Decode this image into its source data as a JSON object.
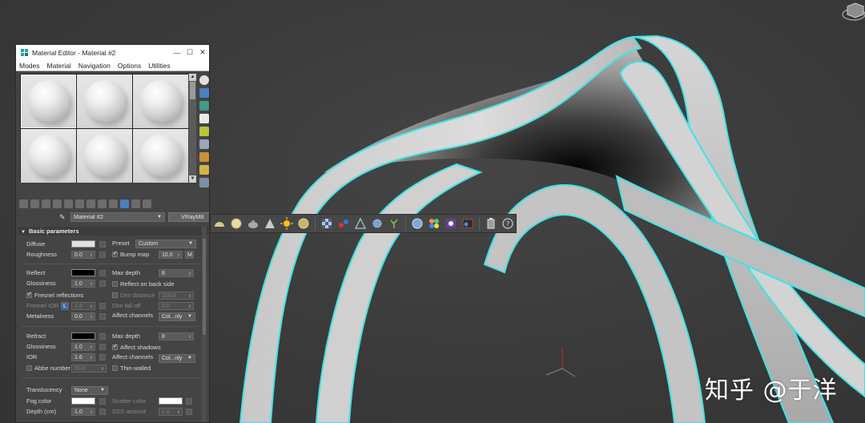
{
  "window": {
    "title": "Material Editor - Material #2",
    "menu": [
      "Modes",
      "Material",
      "Navigation",
      "Options",
      "Utilities"
    ],
    "controls": {
      "minimize": "—",
      "maximize": "☐",
      "close": "✕"
    }
  },
  "material": {
    "name": "Material #2",
    "type": "VRayMtl"
  },
  "rollout": {
    "title": "Basic parameters",
    "diffuse": {
      "label": "Diffuse",
      "color": "#e2e2e2"
    },
    "preset": {
      "label": "Preset",
      "value": "Custom"
    },
    "roughness": {
      "label": "Roughness",
      "value": "0.0"
    },
    "bump_map": {
      "label": "Bump map",
      "value": "10.0",
      "button": "M",
      "checked": true
    },
    "reflect": {
      "label": "Reflect",
      "color": "#000000"
    },
    "reflect_max_depth": {
      "label": "Max depth",
      "value": "8"
    },
    "glossiness": {
      "label": "Glossiness",
      "value": "1.0"
    },
    "reflect_on_back": {
      "label": "Reflect on back side",
      "checked": false
    },
    "fresnel": {
      "label": "Fresnel reflections",
      "checked": true
    },
    "dim_distance": {
      "label": "Dim distance",
      "value": "100.0"
    },
    "fresnel_ior": {
      "label": "Fresnel IOR",
      "lock": "L",
      "value": "1.6"
    },
    "dim_fall_off": {
      "label": "Dim fall off",
      "value": "0.0"
    },
    "metalness": {
      "label": "Metalness",
      "value": "0.0"
    },
    "affect_channels_reflect": {
      "label": "Affect channels",
      "value": "Col...nly"
    },
    "refract": {
      "label": "Refract",
      "color": "#000000"
    },
    "refract_max_depth": {
      "label": "Max depth",
      "value": "8"
    },
    "refract_glossiness": {
      "label": "Glossiness",
      "value": "1.0"
    },
    "affect_shadows": {
      "label": "Affect shadows",
      "checked": true
    },
    "ior": {
      "label": "IOR",
      "value": "1.6"
    },
    "affect_channels_refract": {
      "label": "Affect channels",
      "value": "Col...nly"
    },
    "abbe": {
      "label": "Abbe number",
      "value": "50.0"
    },
    "thin_walled": {
      "label": "Thin-walled",
      "checked": false
    },
    "translucency": {
      "label": "Translucency",
      "value": "None"
    },
    "fog_color": {
      "label": "Fog color",
      "color": "#ffffff"
    },
    "scatter_color": {
      "label": "Scatter color",
      "color": "#ffffff"
    },
    "depth": {
      "label": "Depth (cm)",
      "value": "1.0"
    },
    "sss_amount": {
      "label": "SSS amount",
      "value": "1.0"
    }
  },
  "watermark": "知乎 @于洋",
  "colors": {
    "viewport_bg": "#3b3b3b",
    "selection_outline": "#34e0e0",
    "panel_bg": "#444444",
    "accent": "#4a7fc0"
  },
  "icons": {
    "slot_side_tools": [
      "sample-type-icon",
      "backlight-icon",
      "background-icon",
      "uv-tiling-icon",
      "video-color-check-icon",
      "make-preview-icon",
      "options-icon",
      "select-by-material-icon",
      "material-map-navigator-icon"
    ],
    "floating_toolbar": [
      "hemisphere-icon",
      "sphere-light-icon",
      "teapot-icon",
      "cone-icon",
      "sun-icon",
      "sphere-gold-icon",
      "checker-icon",
      "molecule-icon",
      "scale-icon",
      "gear-sphere-icon",
      "plant-icon",
      "globe-icon",
      "color-dots-icon",
      "material-editor-icon",
      "render-frame-icon",
      "battery-icon",
      "help-icon"
    ]
  }
}
